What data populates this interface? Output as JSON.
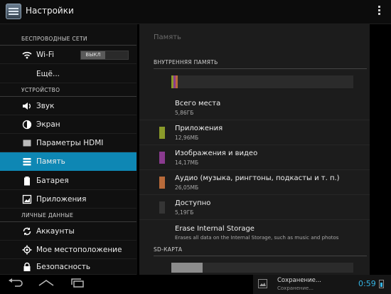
{
  "actionbar": {
    "title": "Настройки"
  },
  "sidebar": {
    "categories": [
      "БЕСПРОВОДНЫЕ СЕТИ",
      "УСТРОЙСТВО",
      "ЛИЧНЫЕ ДАННЫЕ"
    ],
    "items": [
      {
        "label": "Wi-Fi",
        "icon": "wifi-icon"
      },
      {
        "label": "Ещё..."
      },
      {
        "label": "Звук",
        "icon": "volume-icon"
      },
      {
        "label": "Экран",
        "icon": "brightness-icon"
      },
      {
        "label": "Параметры HDMI",
        "icon": "hdmi-icon"
      },
      {
        "label": "Память",
        "icon": "storage-icon",
        "selected": true
      },
      {
        "label": "Батарея",
        "icon": "battery-icon"
      },
      {
        "label": "Приложения",
        "icon": "apps-icon"
      },
      {
        "label": "Аккаунты",
        "icon": "sync-icon"
      },
      {
        "label": "Мое местоположение",
        "icon": "location-icon"
      },
      {
        "label": "Безопасность",
        "icon": "lock-icon"
      }
    ],
    "wifi_toggle": "ВЫКЛ"
  },
  "panel": {
    "title": "Память",
    "internal_header": "ВНУТРЕННЯЯ ПАМЯТЬ",
    "internal_usage_fractions": {
      "apps": 0.01,
      "media": 0.01,
      "audio": 0.01
    },
    "rows": [
      {
        "title": "Всего места",
        "sub": "5,86ГБ"
      },
      {
        "title": "Приложения",
        "sub": "12,96МБ",
        "color": "#8a9a2a"
      },
      {
        "title": "Изображения и видео",
        "sub": "14,17МБ",
        "color": "#8a3b8f"
      },
      {
        "title": "Аудио (музыка, рингтоны, подкасты и т. п.)",
        "sub": "26,05МБ",
        "color": "#b86a3a"
      },
      {
        "title": "Доступно",
        "sub": "5,19ГБ",
        "color": "#353535"
      },
      {
        "title": "Erase Internal Storage",
        "sub": "Erases all data on the Internal Storage, such as music and photos"
      }
    ],
    "sd_header": "SD-КАРТА",
    "sd_usage_fraction": 0.17
  },
  "notification": {
    "title": "Сохранение...",
    "sub": "Сохранение..."
  },
  "status": {
    "clock": "0:59",
    "accent": "#35b5e5"
  }
}
